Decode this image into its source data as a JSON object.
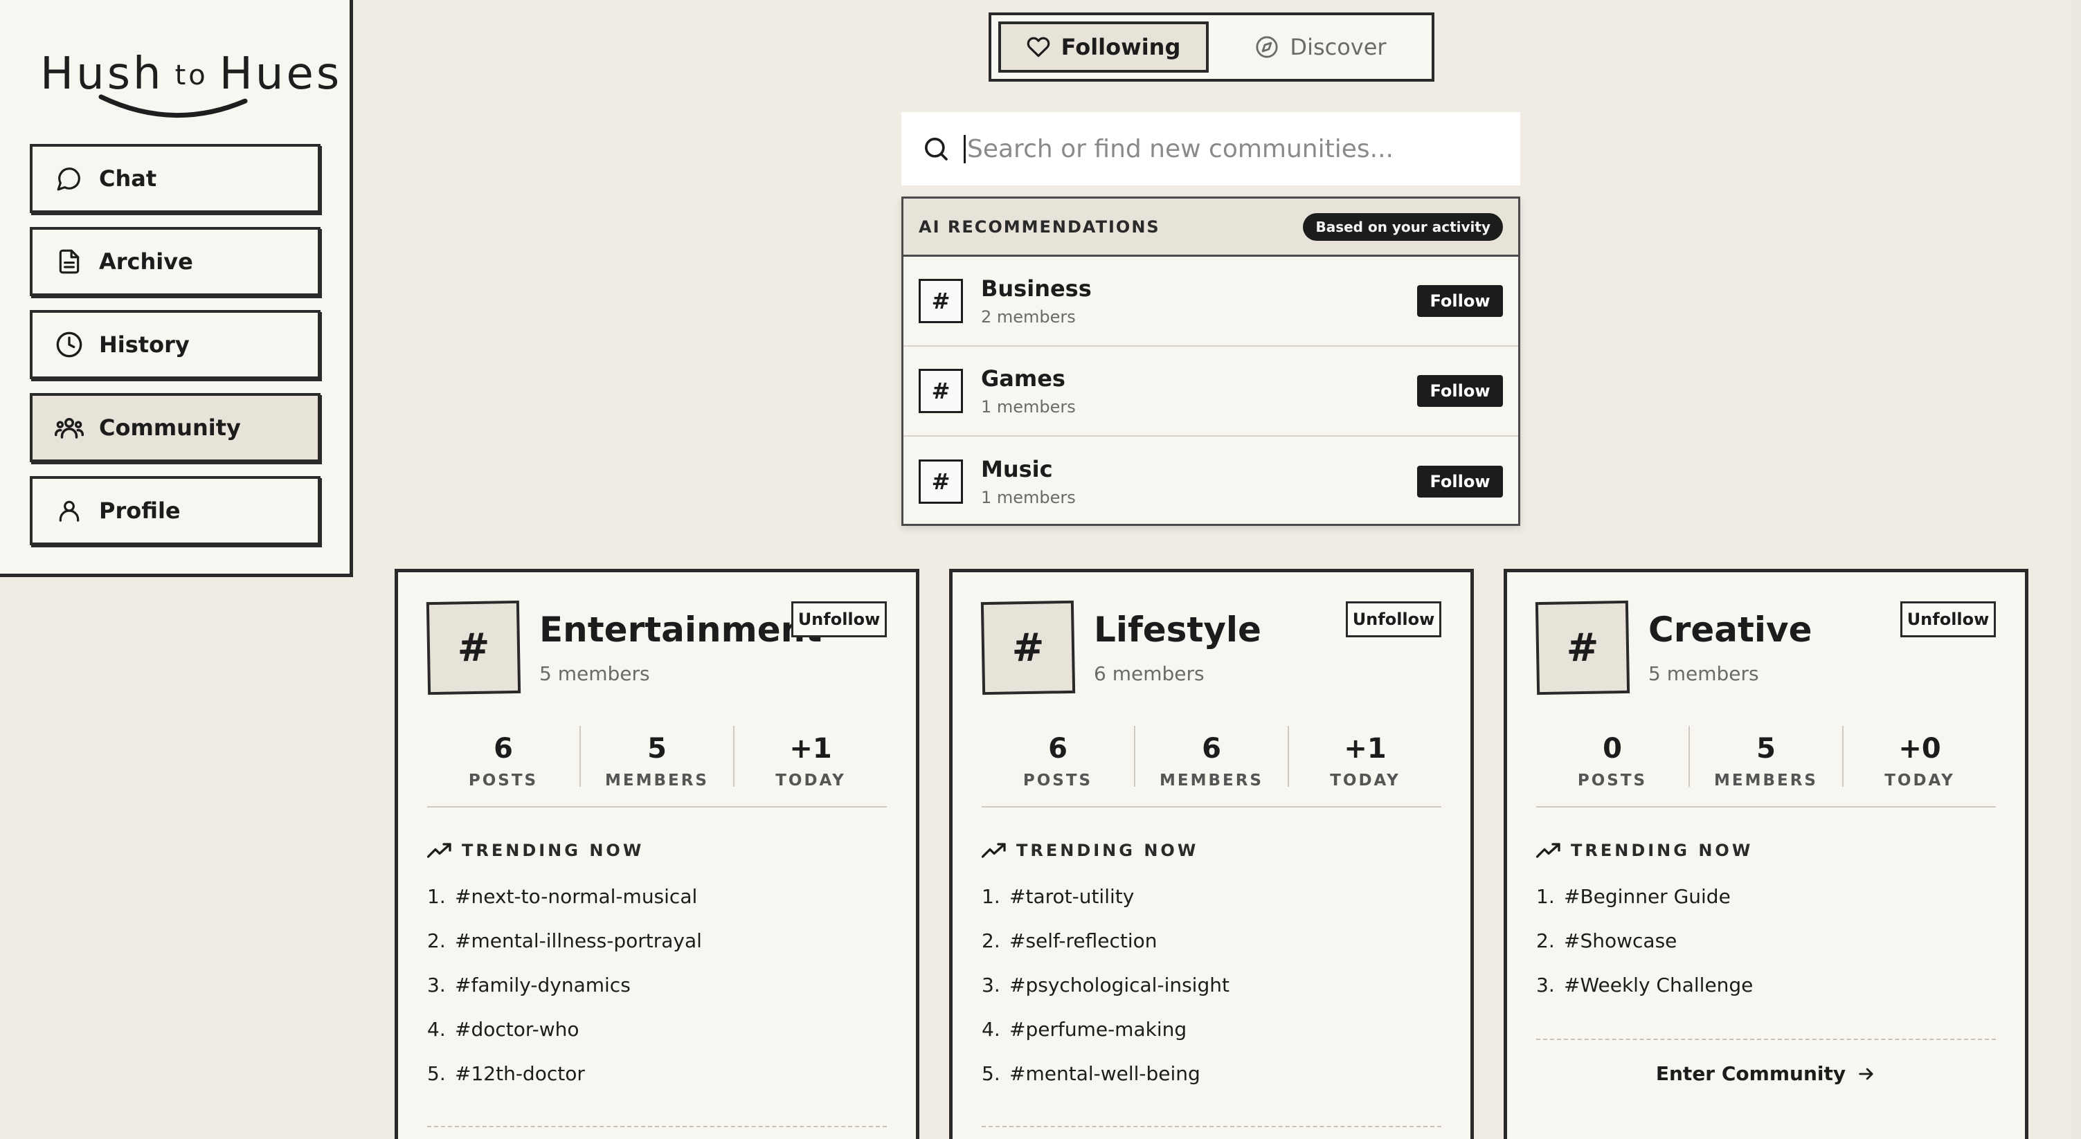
{
  "app": {
    "logo_text_a": "Hush",
    "logo_text_b": "to",
    "logo_text_c": "Hues"
  },
  "sidebar": {
    "items": [
      {
        "label": "Chat",
        "icon": "chat-bubble-icon",
        "active": false
      },
      {
        "label": "Archive",
        "icon": "document-icon",
        "active": false
      },
      {
        "label": "History",
        "icon": "clock-icon",
        "active": false
      },
      {
        "label": "Community",
        "icon": "people-icon",
        "active": true
      },
      {
        "label": "Profile",
        "icon": "user-icon",
        "active": false
      }
    ]
  },
  "toggle": {
    "following_label": "Following",
    "discover_label": "Discover"
  },
  "search": {
    "placeholder": "Search or find new communities..."
  },
  "recommendations": {
    "title": "AI RECOMMENDATIONS",
    "badge": "Based on your activity",
    "items": [
      {
        "name": "Business",
        "members": "2 members",
        "button": "Follow"
      },
      {
        "name": "Games",
        "members": "1 members",
        "button": "Follow"
      },
      {
        "name": "Music",
        "members": "1 members",
        "button": "Follow"
      }
    ]
  },
  "cards": [
    {
      "hash": "#",
      "name": "Entertainment",
      "members": "5 members",
      "unfollow": "Unfollow",
      "stats": [
        {
          "num": "6",
          "label": "POSTS"
        },
        {
          "num": "5",
          "label": "MEMBERS"
        },
        {
          "num": "+1",
          "label": "TODAY"
        }
      ],
      "trending_label": "TRENDING NOW",
      "tags": [
        {
          "idx": "1.",
          "tag": "#next-to-normal-musical"
        },
        {
          "idx": "2.",
          "tag": "#mental-illness-portrayal"
        },
        {
          "idx": "3.",
          "tag": "#family-dynamics"
        },
        {
          "idx": "4.",
          "tag": "#doctor-who"
        },
        {
          "idx": "5.",
          "tag": "#12th-doctor"
        }
      ]
    },
    {
      "hash": "#",
      "name": "Lifestyle",
      "members": "6 members",
      "unfollow": "Unfollow",
      "stats": [
        {
          "num": "6",
          "label": "POSTS"
        },
        {
          "num": "6",
          "label": "MEMBERS"
        },
        {
          "num": "+1",
          "label": "TODAY"
        }
      ],
      "trending_label": "TRENDING NOW",
      "tags": [
        {
          "idx": "1.",
          "tag": "#tarot-utility"
        },
        {
          "idx": "2.",
          "tag": "#self-reflection"
        },
        {
          "idx": "3.",
          "tag": "#psychological-insight"
        },
        {
          "idx": "4.",
          "tag": "#perfume-making"
        },
        {
          "idx": "5.",
          "tag": "#mental-well-being"
        }
      ]
    },
    {
      "hash": "#",
      "name": "Creative",
      "members": "5 members",
      "unfollow": "Unfollow",
      "stats": [
        {
          "num": "0",
          "label": "POSTS"
        },
        {
          "num": "5",
          "label": "MEMBERS"
        },
        {
          "num": "+0",
          "label": "TODAY"
        }
      ],
      "trending_label": "TRENDING NOW",
      "tags": [
        {
          "idx": "1.",
          "tag": "#Beginner Guide"
        },
        {
          "idx": "2.",
          "tag": "#Showcase"
        },
        {
          "idx": "3.",
          "tag": "#Weekly Challenge"
        }
      ],
      "enter_label": "Enter Community"
    }
  ]
}
